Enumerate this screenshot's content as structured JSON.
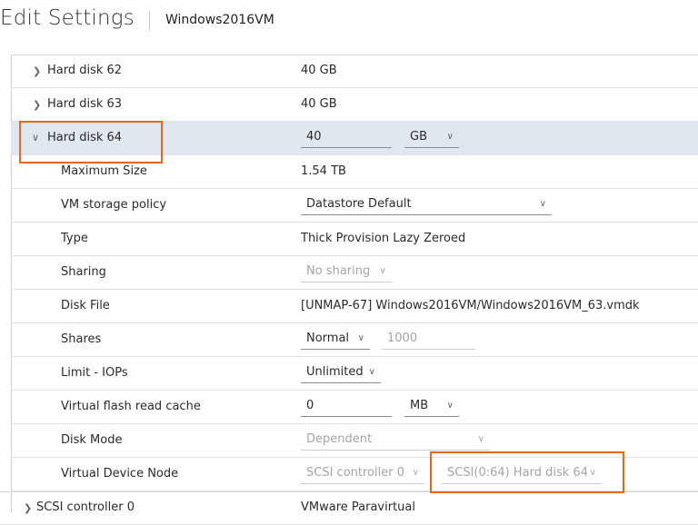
{
  "header": {
    "title": "Edit Settings",
    "vm_name": "Windows2016VM"
  },
  "rows": {
    "hd62": {
      "label": "Hard disk 62",
      "value": "40 GB"
    },
    "hd63": {
      "label": "Hard disk 63",
      "value": "40 GB"
    },
    "hd64": {
      "label": "Hard disk 64",
      "size": "40",
      "unit": "GB"
    },
    "max_size": {
      "label": "Maximum Size",
      "value": "1.54 TB"
    },
    "storage_policy": {
      "label": "VM storage policy",
      "value": "Datastore Default"
    },
    "type": {
      "label": "Type",
      "value": "Thick Provision Lazy Zeroed"
    },
    "sharing": {
      "label": "Sharing",
      "value": "No sharing"
    },
    "disk_file": {
      "label": "Disk File",
      "value": "[UNMAP-67] Windows2016VM/Windows2016VM_63.vmdk"
    },
    "shares": {
      "label": "Shares",
      "value": "Normal",
      "number": "1000"
    },
    "limit_iops": {
      "label": "Limit - IOPs",
      "value": "Unlimited"
    },
    "flash_cache": {
      "label": "Virtual flash read cache",
      "value": "0",
      "unit": "MB"
    },
    "disk_mode": {
      "label": "Disk Mode",
      "value": "Dependent"
    },
    "device_node": {
      "label": "Virtual Device Node",
      "controller": "SCSI controller 0",
      "node": "SCSI(0:64) Hard disk 64"
    },
    "scsi_ctrl": {
      "label": "SCSI controller 0",
      "value": "VMware Paravirtual"
    }
  },
  "colors": {
    "highlight_border": "#e8671d",
    "selected_row": "#e0e7ee"
  },
  "icons": {
    "collapsed": "chevron-right-icon",
    "expanded": "chevron-down-icon",
    "dropdown": "chevron-down-icon"
  }
}
